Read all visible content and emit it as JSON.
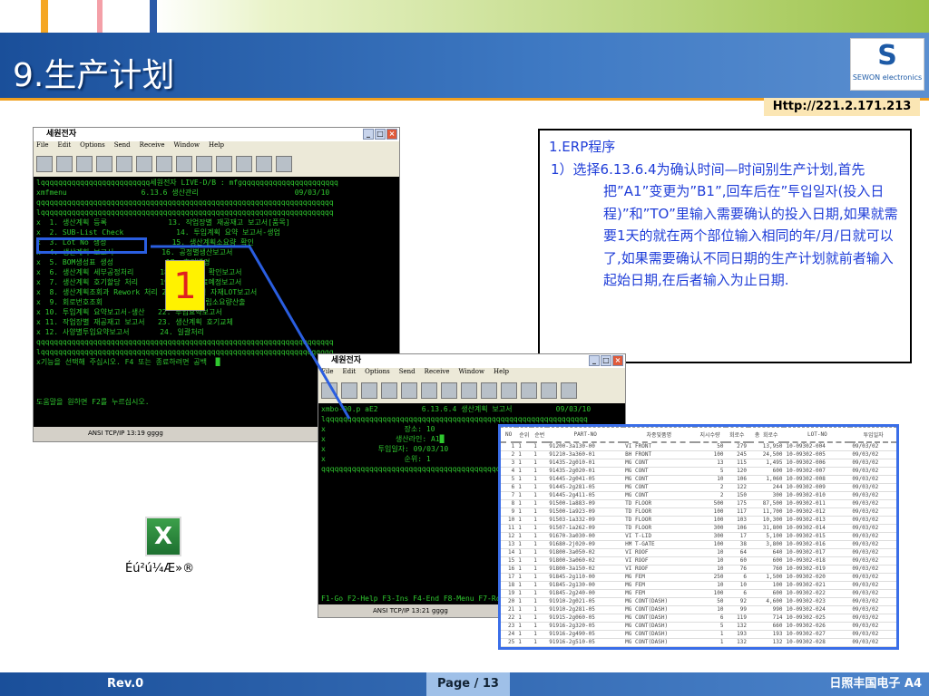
{
  "slide": {
    "title": "9.生产计划",
    "url": "Http://221.2.171.213",
    "logo_text": "SEWON electronics",
    "footer_left": "Rev.0",
    "footer_page": "Page / 13",
    "footer_right": "日照丰国电子 A4",
    "callout_number": "1",
    "excel_label": "Éú²ú¼Æ»®"
  },
  "colors": {
    "accent": "#1a4f9a",
    "text_blue": "#1f3dd8",
    "callout": "#2a5ee0",
    "highlight": "#fff200"
  },
  "window1": {
    "title": "세원전자",
    "menu": [
      "File",
      "Edit",
      "Options",
      "Send",
      "Receive",
      "Window",
      "Help"
    ],
    "lines": [
      "lqqqqqqqqqqqqqqqqqqqqqqqqq세원전자 LIVE-D/B : mfgqqqqqqqqqqqqqqqqqqqqqq",
      "xmfmenu                 6.13.6 생산관리                      09/03/10",
      "qqqqqqqqqqqqqqqqqqqqqqqqqqqqqqqqqqqqqqqqqqqqqqqqqqqqqqqqqqqqqqqqqqqq",
      "lqqqqqqqqqqqqqqqqqqqqqqqqqqqqqqqqqqqqqqqqqqqqqqqqqqqqqqqqqqqqqqqqqqq",
      "x  1. 생산계획 등록              13. 작업장별 재공재고 보고서[품목]",
      "x  2. SUB-List Check            14. 투입계획 요약 보고서-생업",
      "x  3. Lot No 생성               15. 생산계획소요량 확인",
      "x  4. 생산계획 보고서           16. 공정별생산보고서",
      "x  5. BOM생성표 생성            17. 호기변경",
      "x  6. 생산계획 세부공정처리      18. 생산계획 확인보고서",
      "x  7. 생산계획 호기할당 처리     19. SET 완료예정보고서",
      "x  8. 생산계획조회과 Rework 처리 20. 가공실적 자재LOT보고서",
      "x  9. 회로번호조회               21. sub조립소요량산출",
      "x 10. 투입계획 요약보고서-생산   22. 투입요약보고서",
      "x 11. 작업장별 재공재고 보고서   23. 생산계획 호기교체",
      "x 12. 사양별투입요약보고서       24. 일괄처리",
      "qqqqqqqqqqqqqqqqqqqqqqqqqqqqqqqqqqqqqqqqqqqqqqqqqqqqqqqqqqqqqqqqqqqq",
      "lqqqqqqqqqqqqqqqqqqqqqqqqqqqqqqqqqqqqqqqqqqqqqqqqqqqqqqqqqqqqqqqqqqq",
      "x기능을 선택해 주십시오. F4 또는 종료하려면 공백  █",
      "",
      "",
      "",
      "도움말을 원하면 F2를 누르십시오."
    ],
    "status": "ANSI  TCP/IP  13:19  gggg"
  },
  "window2": {
    "title": "세원전자",
    "menu": [
      "File",
      "Edit",
      "Options",
      "Send",
      "Receive",
      "Window",
      "Help"
    ],
    "lines": [
      "xmbo-00.p aE2          6.13.6.4 생산계획 보고서          09/03/10",
      "lqqqqqqqqqqqqqqqqqqqqqqqqqqqqqqqqqqqqqqqqqqqqqqqqqqqqqqqqqqqq",
      "x                  장소: 10",
      "x                생산라인: A1█",
      "x            투입일자: 09/03/10              To: 09",
      "x                  순위: 1                   To: 99",
      "qqqqqqqqqqqqqqqqqqqqqqqqqqqqqqqqqqqqqqqqqqqqqqqqqqqqqqqqqqqq",
      "",
      "",
      "",
      "",
      "",
      "",
      "",
      "",
      "",
      "",
      "",
      "",
      "F1-Go F2-Help F3-Ins F4-End F8-Menu F7-Rcl F8-Clr"
    ],
    "status": "ANSI  TCP/IP  13:21  gggg"
  },
  "textbox": {
    "heading": "1.ERP程序",
    "item": "1）选择6.13.6.4为确认时间—时间别生产计划,首先把”A1”变更为”B1”,回车后在”투입일자(投入日程)”和”TO”里输入需要确认的投入日期,如果就需要1天的就在两个部位输入相同的年/月/日就可以了,如果需要确认不同日期的生产计划就前者输入起始日期,在后者输入为止日期."
  },
  "table": {
    "headers": [
      "NO",
      "순위",
      "순번",
      "PART-NO",
      "차종및품명",
      "지시수량",
      "회로수",
      "총 회로수",
      "LOT-NO",
      "투입일자"
    ],
    "rows": [
      [
        "1",
        "1",
        "1",
        "91200-3a130-00",
        "VI FRONT",
        "50",
        "279",
        "13,950",
        "10-09302-004",
        "09/03/02"
      ],
      [
        "2",
        "1",
        "1",
        "91210-3a360-01",
        "BH FRONT",
        "100",
        "245",
        "24,500",
        "10-09302-005",
        "09/03/02"
      ],
      [
        "3",
        "1",
        "1",
        "91435-2g010-01",
        "MG CONT",
        "13",
        "115",
        "1,495",
        "10-09302-006",
        "09/03/02"
      ],
      [
        "4",
        "1",
        "1",
        "91435-2g020-01",
        "MG CONT",
        "5",
        "120",
        "600",
        "10-09302-007",
        "09/03/02"
      ],
      [
        "5",
        "1",
        "1",
        "91445-2g041-05",
        "MG CONT",
        "10",
        "106",
        "1,060",
        "10-09302-008",
        "09/03/02"
      ],
      [
        "6",
        "1",
        "1",
        "91445-2g281-05",
        "MG CONT",
        "2",
        "122",
        "244",
        "10-09302-009",
        "09/03/02"
      ],
      [
        "7",
        "1",
        "1",
        "91445-2g411-05",
        "MG CONT",
        "2",
        "150",
        "300",
        "10-09302-010",
        "09/03/02"
      ],
      [
        "8",
        "1",
        "1",
        "91500-1a883-09",
        "TD FLOOR",
        "500",
        "175",
        "87,500",
        "10-09302-011",
        "09/03/02"
      ],
      [
        "9",
        "1",
        "1",
        "91500-1a923-09",
        "TD FLOOR",
        "100",
        "117",
        "11,700",
        "10-09302-012",
        "09/03/02"
      ],
      [
        "10",
        "1",
        "1",
        "91503-1a332-09",
        "TD FLOOR",
        "100",
        "103",
        "10,300",
        "10-09302-013",
        "09/03/02"
      ],
      [
        "11",
        "1",
        "1",
        "91507-1a262-09",
        "TD FLOOR",
        "300",
        "106",
        "31,800",
        "10-09302-014",
        "09/03/02"
      ],
      [
        "12",
        "1",
        "1",
        "91670-3a030-00",
        "VI T-LID",
        "300",
        "17",
        "5,100",
        "10-09302-015",
        "09/03/02"
      ],
      [
        "13",
        "1",
        "1",
        "91680-2j020-09",
        "HM T-GATE",
        "100",
        "38",
        "3,800",
        "10-09302-016",
        "09/03/02"
      ],
      [
        "14",
        "1",
        "1",
        "91800-3a050-02",
        "VI ROOF",
        "10",
        "64",
        "640",
        "10-09302-017",
        "09/03/02"
      ],
      [
        "15",
        "1",
        "1",
        "91800-3a060-02",
        "VI ROOF",
        "10",
        "60",
        "600",
        "10-09302-018",
        "09/03/02"
      ],
      [
        "16",
        "1",
        "1",
        "91800-3a150-02",
        "VI ROOF",
        "10",
        "76",
        "760",
        "10-09302-019",
        "09/03/02"
      ],
      [
        "17",
        "1",
        "1",
        "91845-2g110-00",
        "MG FEM",
        "250",
        "6",
        "1,500",
        "10-09302-020",
        "09/03/02"
      ],
      [
        "18",
        "1",
        "1",
        "91845-2g130-00",
        "MG FEM",
        "10",
        "10",
        "100",
        "10-09302-021",
        "09/03/02"
      ],
      [
        "19",
        "1",
        "1",
        "91845-2g240-00",
        "MG FEM",
        "100",
        "6",
        "600",
        "10-09302-022",
        "09/03/02"
      ],
      [
        "20",
        "1",
        "1",
        "91910-2g021-05",
        "MG CONT(DASH)",
        "50",
        "92",
        "4,600",
        "10-09302-023",
        "09/03/02"
      ],
      [
        "21",
        "1",
        "1",
        "91910-2g281-05",
        "MG CONT(DASH)",
        "10",
        "99",
        "990",
        "10-09302-024",
        "09/03/02"
      ],
      [
        "22",
        "1",
        "1",
        "91915-2g060-05",
        "MG CONT(DASH)",
        "6",
        "119",
        "714",
        "10-09302-025",
        "09/03/02"
      ],
      [
        "23",
        "1",
        "1",
        "91916-2g320-05",
        "MG CONT(DASH)",
        "5",
        "132",
        "660",
        "10-09302-026",
        "09/03/02"
      ],
      [
        "24",
        "1",
        "1",
        "91916-2g490-05",
        "MG CONT(DASH)",
        "1",
        "193",
        "193",
        "10-09302-027",
        "09/03/02"
      ],
      [
        "25",
        "1",
        "1",
        "91916-2g510-05",
        "MG CONT(DASH)",
        "1",
        "132",
        "132",
        "10-09302-028",
        "09/03/02"
      ]
    ]
  }
}
